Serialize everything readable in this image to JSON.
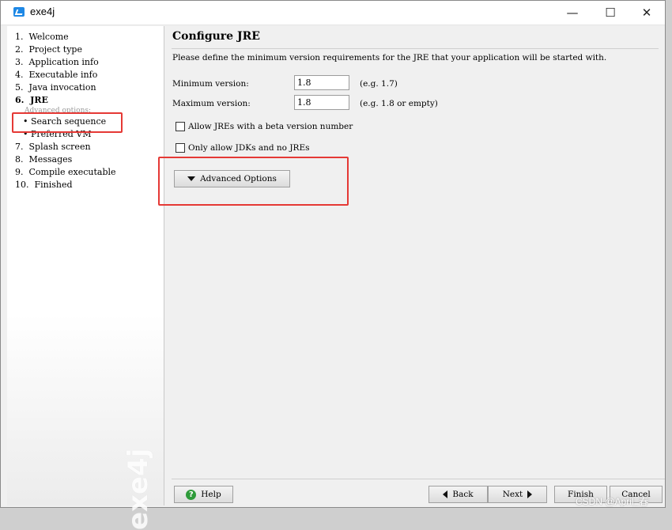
{
  "window": {
    "title": "exe4j"
  },
  "sidebar": {
    "items": [
      {
        "label": "1.  Welcome"
      },
      {
        "label": "2.  Project type"
      },
      {
        "label": "3.  Application info"
      },
      {
        "label": "4.  Executable info"
      },
      {
        "label": "5.  Java invocation"
      },
      {
        "label": "6.  JRE"
      }
    ],
    "advanced_caption": "Advanced options:",
    "sub_items": [
      {
        "label": "• Search sequence"
      },
      {
        "label": "• Preferred VM"
      }
    ],
    "items_after": [
      {
        "label": "7.  Splash screen"
      },
      {
        "label": "8.  Messages"
      },
      {
        "label": "9.  Compile executable"
      },
      {
        "label": "10.  Finished"
      }
    ],
    "watermark": "exe4j"
  },
  "main": {
    "heading": "Configure JRE",
    "description": "Please define the minimum version requirements for the JRE that your application will be started with.",
    "min_label": "Minimum version:",
    "min_value": "1.8",
    "min_hint": "(e.g. 1.7)",
    "max_label": "Maximum version:",
    "max_value": "1.8",
    "max_hint": "(e.g. 1.8 or empty)",
    "beta_checkbox": "Allow JREs with a beta version number",
    "jdk_checkbox": "Only allow JDKs and no JREs",
    "advanced_button": "Advanced Options"
  },
  "buttons": {
    "help": "Help",
    "back": "Back",
    "next": "Next",
    "finish": "Finish",
    "cancel": "Cancel"
  },
  "watermark_credit": "CSDN @April_春"
}
